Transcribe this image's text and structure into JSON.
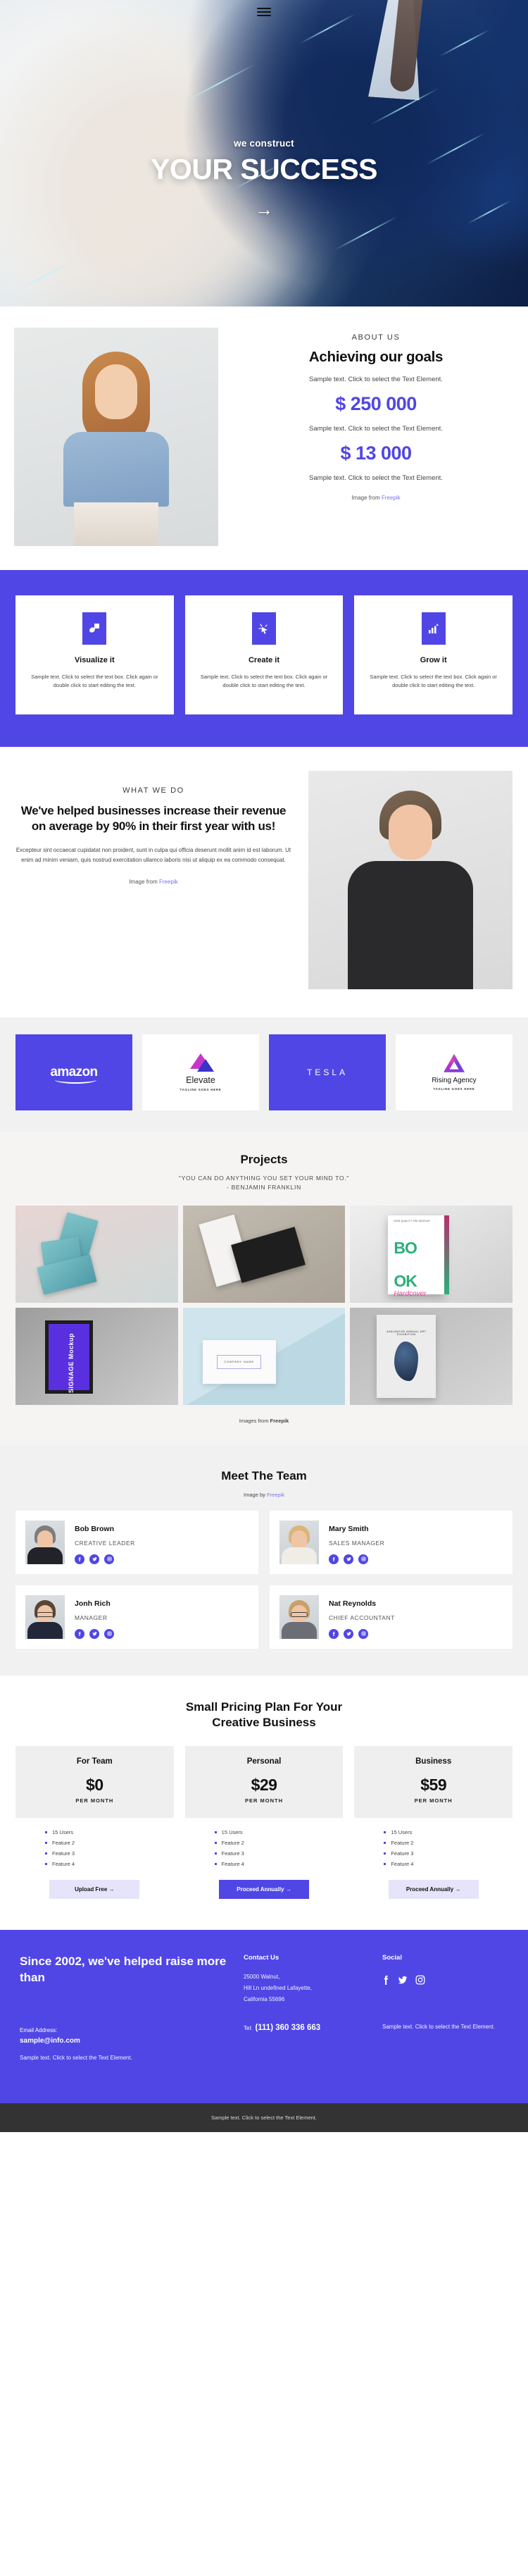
{
  "hero": {
    "menu_icon": "hamburger-menu-icon",
    "subtitle": "we construct",
    "title": "YOUR SUCCESS",
    "arrow": "→"
  },
  "about": {
    "eyebrow": "ABOUT US",
    "heading": "Achieving our goals",
    "text_1": "Sample text. Click to select the Text Element.",
    "stat_1": "$ 250 000",
    "text_2": "Sample text. Click to select the Text Element.",
    "stat_2": "$ 13 000",
    "text_3": "Sample text. Click to select the Text Element.",
    "credit_prefix": "Image from ",
    "credit_link": "Freepik",
    "accent_color": "#5046e5"
  },
  "features": {
    "background_color": "#5046e5",
    "cards": [
      {
        "icon": "shapes-icon",
        "title": "Visualize it",
        "text": "Sample text. Click to select the text box. Click again or double click to start editing the text."
      },
      {
        "icon": "cursor-spark-icon",
        "title": "Create it",
        "text": "Sample text. Click to select the text box. Click again or double click to start editing the text."
      },
      {
        "icon": "bar-chart-growth-icon",
        "title": "Grow it",
        "text": "Sample text. Click to select the text box. Click again or double click to start editing the text."
      }
    ]
  },
  "whatwedo": {
    "eyebrow": "WHAT WE DO",
    "heading": "We've helped businesses increase their revenue on average by 90% in their first year with us!",
    "paragraph": "Excepteur sint occaecat cupidatat non proident, sunt in culpa qui officia deserunt mollit anim id est laborum. Ut enim ad minim veniam, quis nostrud exercitation ullamco laboris nisi ut aliquip ex ea commodo consequat.",
    "credit_prefix": "Image from ",
    "credit_link": "Freepik"
  },
  "logos": [
    {
      "name": "amazon",
      "style": "purple",
      "tagline": ""
    },
    {
      "name": "Elevate",
      "style": "white",
      "tagline": "TAGLINE GOES HERE"
    },
    {
      "name": "TESLA",
      "style": "purple",
      "tagline": ""
    },
    {
      "name": "Rising Agency",
      "style": "white",
      "tagline": "TAGLINE GOES HERE"
    }
  ],
  "projects": {
    "heading": "Projects",
    "quote_line_1": "\"YOU CAN DO ANYTHING YOU SET YOUR MIND TO.\"",
    "quote_line_2": "- BENJAMIN FRANKLIN",
    "tiles": [
      {
        "label": "Book Covers Mockup"
      },
      {
        "label": "Business Card Mockup"
      },
      {
        "label": "BOOK Hardcover Mockup"
      },
      {
        "label": "SIGNAGE Mockup"
      },
      {
        "label": "COMPANY NAME Card"
      },
      {
        "label": "Avalanche Annual Art Exhibition Poster"
      }
    ],
    "tile_3_title_line1": "BO",
    "tile_3_title_line2": "OK",
    "tile_3_script": "Hardcover",
    "tile_3_top": "HIGH QUALITY PSD MOCKUP",
    "tile_4_text": "SIGNAGE Mockup",
    "tile_5_text": "COMPANY NAME",
    "tile_6_text": "AVALANCHE ANNUAL ART EXHIBITION",
    "credit_prefix": "Images from ",
    "credit_link": "Freepik"
  },
  "team": {
    "heading": "Meet The Team",
    "credit_prefix": "Image by ",
    "credit_link": "Freepik",
    "members": [
      {
        "name": "Bob Brown",
        "role": "CREATIVE LEADER",
        "hair": "#7d7d7d",
        "body": "#222229",
        "glasses": false
      },
      {
        "name": "Mary Smith",
        "role": "SALES MANAGER",
        "hair": "#d9b678",
        "body": "#f0ece6",
        "glasses": false
      },
      {
        "name": "Jonh Rich",
        "role": "MANAGER",
        "hair": "#5b4634",
        "body": "#22283a",
        "glasses": true
      },
      {
        "name": "Nat Reynolds",
        "role": "CHIEF ACCOUNTANT",
        "hair": "#c9a06a",
        "body": "#6b6f75",
        "glasses": true
      }
    ],
    "social_icons": [
      "facebook-icon",
      "twitter-icon",
      "instagram-icon"
    ]
  },
  "pricing": {
    "heading_line_1": "Small Pricing Plan For Your",
    "heading_line_2": "Creative Business",
    "plans": [
      {
        "name": "For Team",
        "price": "$0",
        "per": "PER MONTH",
        "features": [
          "15 Users",
          "Feature 2",
          "Feature 3",
          "Feature 4"
        ],
        "cta": "Upload Free →",
        "cta_style": "light"
      },
      {
        "name": "Personal",
        "price": "$29",
        "per": "PER MONTH",
        "features": [
          "15 Users",
          "Feature 2",
          "Feature 3",
          "Feature 4"
        ],
        "cta": "Proceed Annually →",
        "cta_style": "solid"
      },
      {
        "name": "Business",
        "price": "$59",
        "per": "PER MONTH",
        "features": [
          "15 Users",
          "Feature 2",
          "Feature 3",
          "Feature 4"
        ],
        "cta": "Proceed Annually →",
        "cta_style": "light"
      }
    ]
  },
  "footer": {
    "heading": "Since 2002, we've helped raise more than",
    "email_label": "Email Address:",
    "email": "sample@info.com",
    "note": "Sample text. Click to select the Text Element.",
    "contact_heading": "Contact Us",
    "address_line_1": "25000 Walnut,",
    "address_line_2": "Hill Ln undefined Lafayette,",
    "address_line_3": "California 55696",
    "tel_label": "Tel:",
    "tel": "(111) 360 336 663",
    "social_heading": "Social",
    "social_icons": [
      "facebook-icon",
      "twitter-icon",
      "instagram-icon"
    ],
    "social_note": "Sample text. Click to select the Text Element.",
    "bottom_bar": "Sample text. Click to select the Text Element.",
    "background_color": "#5046e5",
    "bottom_bar_color": "#333333"
  }
}
